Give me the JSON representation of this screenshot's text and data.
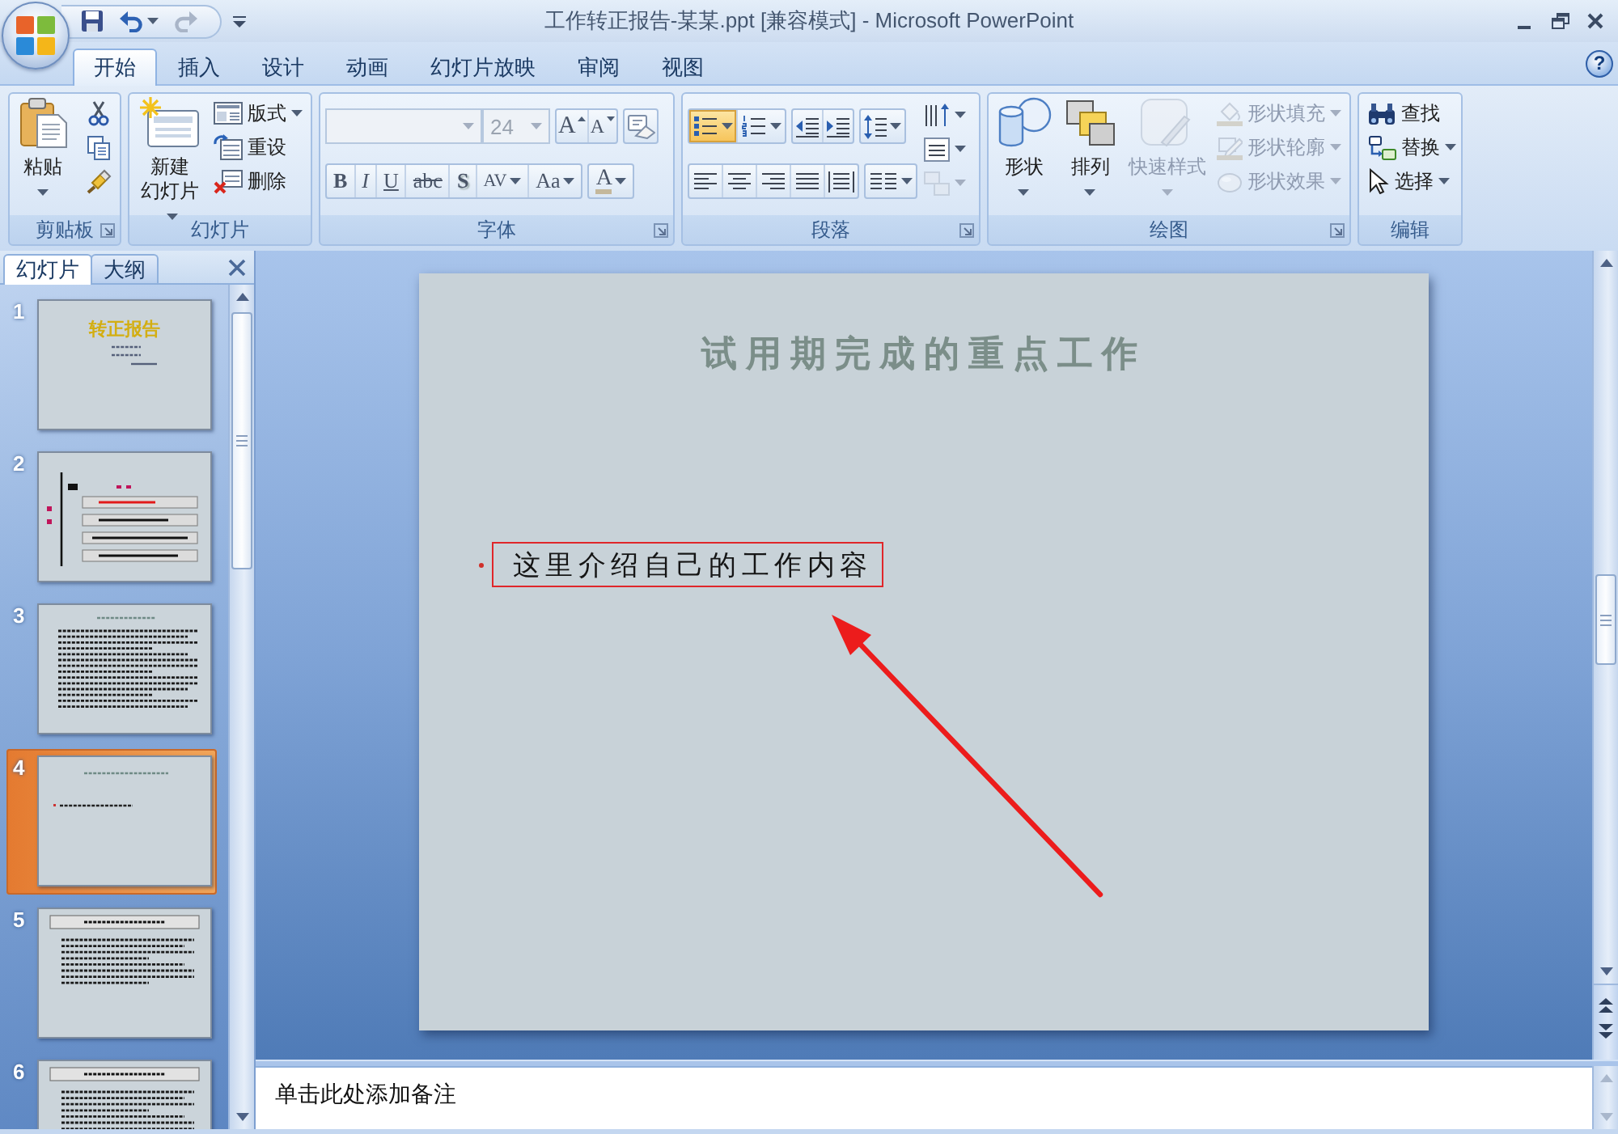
{
  "window": {
    "title": "工作转正报告-某某.ppt [兼容模式] - Microsoft PowerPoint",
    "quick_access": [
      {
        "kind": "save",
        "disabled": false
      },
      {
        "kind": "undo",
        "disabled": false
      },
      {
        "kind": "redo",
        "disabled": true
      }
    ]
  },
  "tabs": [
    {
      "label": "开始",
      "selected": true
    },
    {
      "label": "插入",
      "selected": false
    },
    {
      "label": "设计",
      "selected": false
    },
    {
      "label": "动画",
      "selected": false
    },
    {
      "label": "幻灯片放映",
      "selected": false
    },
    {
      "label": "审阅",
      "selected": false
    },
    {
      "label": "视图",
      "selected": false
    }
  ],
  "help": "?",
  "ribbon": {
    "clipboard": {
      "label": "剪贴板",
      "paste": "粘贴"
    },
    "slides": {
      "label": "幻灯片",
      "new_slide": "新建幻灯片",
      "commands": [
        {
          "kind": "layout",
          "label": "版式"
        },
        {
          "kind": "reset",
          "label": "重设"
        },
        {
          "kind": "delete",
          "label": "删除"
        }
      ]
    },
    "font": {
      "label": "字体",
      "font_name": {
        "disabled": true
      },
      "font_size": {
        "value": "24",
        "disabled": true
      },
      "grow": "A",
      "shrink": "A",
      "format_buttons": [
        {
          "kind": "bold",
          "label": "B"
        },
        {
          "kind": "italic",
          "label": "I"
        },
        {
          "kind": "underline",
          "label": "U"
        },
        {
          "kind": "strike",
          "label": "abc"
        },
        {
          "kind": "shadow",
          "label": "S"
        },
        {
          "kind": "spacing",
          "label": "AV"
        },
        {
          "kind": "case",
          "label": "Aa"
        }
      ],
      "font_color": "A"
    },
    "paragraph": {
      "label": "段落",
      "list_buttons": [
        {
          "kind": "bullets",
          "selected": true
        },
        {
          "kind": "numbering",
          "selected": false
        }
      ],
      "align_buttons": [
        {
          "kind": "left",
          "selected": false
        },
        {
          "kind": "center",
          "selected": false
        },
        {
          "kind": "right",
          "selected": false
        },
        {
          "kind": "justify",
          "selected": false
        },
        {
          "kind": "distributed",
          "selected": false
        }
      ],
      "text_buttons": [
        {
          "kind": "direction",
          "disabled": false
        },
        {
          "kind": "align-text",
          "disabled": false
        },
        {
          "kind": "smartart",
          "disabled": true
        }
      ]
    },
    "drawing": {
      "label": "绘图",
      "shapes": "形状",
      "arrange": "排列",
      "quick_styles": {
        "label": "快速样式",
        "disabled": true
      },
      "shape_options": [
        {
          "kind": "fill",
          "label": "形状填充",
          "disabled": true
        },
        {
          "kind": "outline",
          "label": "形状轮廓",
          "disabled": true
        },
        {
          "kind": "effects",
          "label": "形状效果",
          "disabled": true
        }
      ]
    },
    "editing": {
      "label": "编辑",
      "commands": [
        {
          "kind": "find",
          "label": "查找"
        },
        {
          "kind": "replace",
          "label": "替换"
        },
        {
          "kind": "select",
          "label": "选择"
        }
      ]
    }
  },
  "slide_pane": {
    "tabs": [
      {
        "label": "幻灯片",
        "selected": true
      },
      {
        "label": "大纲",
        "selected": false
      }
    ],
    "thumbnails": [
      {
        "number": "1",
        "kind": "title",
        "title": "转正报告",
        "selected": false
      },
      {
        "number": "2",
        "kind": "diagram",
        "selected": false
      },
      {
        "number": "3",
        "kind": "text",
        "selected": false
      },
      {
        "number": "4",
        "kind": "bullet",
        "selected": true
      },
      {
        "number": "5",
        "kind": "banner",
        "selected": false
      },
      {
        "number": "6",
        "kind": "banner",
        "selected": false
      }
    ]
  },
  "slide": {
    "title": "试用期完成的重点工作",
    "body": "这里介绍自己的工作内容"
  },
  "notes": {
    "placeholder": "单击此处添加备注"
  }
}
